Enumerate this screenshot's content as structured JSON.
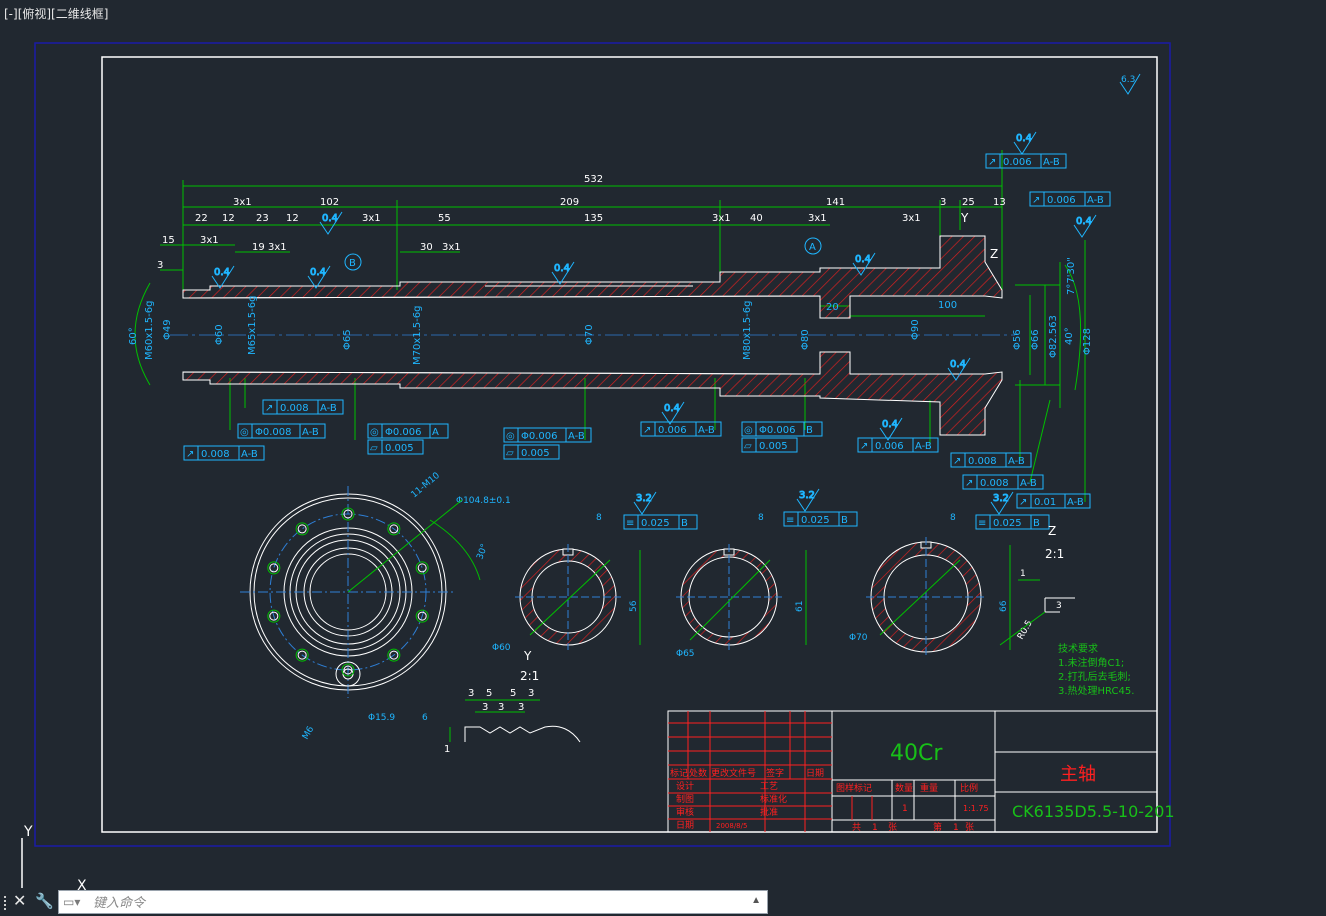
{
  "viewport": {
    "label": "[-][俯视][二维线框]"
  },
  "ucs": {
    "y_label": "Y",
    "x_label": "X"
  },
  "command_line": {
    "placeholder": "键入命令",
    "close_icon": "close-icon",
    "settings_icon": "wrench-icon"
  },
  "colors": {
    "background": "#212830",
    "frame": "#ffffff",
    "dimension": "#00c000",
    "gdt": "#1fb6ff",
    "hatch": "#d42020",
    "centerline": "#2e7fd6",
    "title_red": "#ff2020",
    "title_green": "#18c018",
    "viewport_border": "#1a1aa8"
  },
  "drawing": {
    "roughness_general": "6.3",
    "roughness_marks": [
      "0.4",
      "0.4",
      "0.4",
      "0.4",
      "0.4",
      "0.4",
      "0.4",
      "0.4",
      "0.4",
      "0.4",
      "3.2",
      "3.2",
      "3.2"
    ],
    "overall_length": "532",
    "top_dims": [
      "102",
      "209",
      "141",
      "3",
      "25",
      "13",
      "22",
      "12",
      "3x1",
      "3x1",
      "23",
      "12",
      "55",
      "3x1",
      "135",
      "3x1",
      "40",
      "3x1",
      "3x1",
      "15",
      "3x1",
      "19",
      "3x1",
      "30",
      "3x1",
      "3"
    ],
    "section_labels": [
      "B",
      "A",
      "Y",
      "Z"
    ],
    "diameters": [
      "60°",
      "M60x1.5-6g",
      "Φ49",
      "Φ60",
      "M65x1.5-6g",
      "Φ65",
      "M70x1.5-6g",
      "Φ70",
      "M80x1.5-6g",
      "Φ80",
      "20",
      "Φ90",
      "100",
      "Φ56",
      "Φ66",
      "Φ82.563",
      "Φ128",
      "40°",
      "7°7'30\""
    ],
    "gdt_frames": [
      {
        "sym": "↗",
        "tol": "0.006",
        "ref": "A-B"
      },
      {
        "sym": "↗",
        "tol": "0.006",
        "ref": "A-B"
      },
      {
        "sym": "↗",
        "tol": "0.008",
        "ref": "A-B"
      },
      {
        "sym": "◎",
        "tol": "Φ0.008",
        "ref": "A-B"
      },
      {
        "sym": "↗",
        "tol": "0.008",
        "ref": "A-B"
      },
      {
        "sym": "◎",
        "tol": "Φ0.006",
        "ref": "A"
      },
      {
        "sym": "▱",
        "tol": "0.005",
        "ref": ""
      },
      {
        "sym": "◎",
        "tol": "Φ0.006",
        "ref": "A-B"
      },
      {
        "sym": "▱",
        "tol": "0.005",
        "ref": ""
      },
      {
        "sym": "↗",
        "tol": "0.006",
        "ref": "A-B"
      },
      {
        "sym": "◎",
        "tol": "Φ0.006",
        "ref": "B"
      },
      {
        "sym": "▱",
        "tol": "0.005",
        "ref": ""
      },
      {
        "sym": "↗",
        "tol": "0.006",
        "ref": "A-B"
      },
      {
        "sym": "↗",
        "tol": "0.008",
        "ref": "A-B"
      },
      {
        "sym": "↗",
        "tol": "0.008",
        "ref": "A-B"
      },
      {
        "sym": "↗",
        "tol": "0.01",
        "ref": "A-B"
      },
      {
        "sym": "≡",
        "tol": "0.025",
        "ref": "B"
      },
      {
        "sym": "≡",
        "tol": "0.025",
        "ref": "B"
      },
      {
        "sym": "≡",
        "tol": "0.025",
        "ref": "B"
      }
    ],
    "flange": {
      "holes": "11-M10",
      "bolt_circle": "Φ104.8±0.1",
      "angle": "30°",
      "pin": "Φ15.9",
      "pin_depth": "6",
      "thread": "M6"
    },
    "sections": [
      {
        "key": "8",
        "dim": "56",
        "dia": "Φ60",
        "label": "Y",
        "scale": "2:1"
      },
      {
        "key": "8",
        "dim": "61",
        "dia": "Φ65"
      },
      {
        "key": "8",
        "dim": "66",
        "dia": "Φ70"
      }
    ],
    "detail_z": {
      "label": "Z",
      "scale": "2:1",
      "dims": [
        "1",
        "3",
        "R0.5"
      ]
    },
    "thread_detail": {
      "dims": [
        "3",
        "5",
        "5",
        "3",
        "3",
        "3",
        "3",
        "1"
      ]
    },
    "tech_requirements": {
      "title": "技术要求",
      "items": [
        "1.未注倒角C1;",
        "2.打孔后去毛刺;",
        "3.热处理HRC45."
      ]
    }
  },
  "title_block": {
    "material": "40Cr",
    "part_name": "主轴",
    "drawing_no": "CK6135D5.5-10-201",
    "header_row": [
      "标记",
      "处数",
      "更改文件号",
      "签字",
      "日期"
    ],
    "rows": [
      [
        "设计",
        "",
        "工艺"
      ],
      [
        "制图",
        "",
        "标准化"
      ],
      [
        "审核",
        "",
        "批准"
      ],
      [
        "日期",
        "2008/8/5",
        ""
      ]
    ],
    "mid_header": [
      "图样标记",
      "数量",
      "重量",
      "比例"
    ],
    "quantity": "1",
    "scale": "1:1.75",
    "sheet": [
      "共",
      "1",
      "张",
      "第",
      "1",
      "张"
    ]
  }
}
